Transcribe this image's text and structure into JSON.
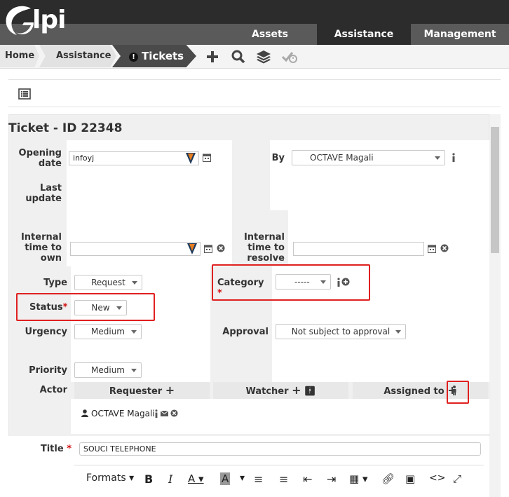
{
  "app": {
    "logo_text": "lpi"
  },
  "menu": {
    "assets": "Assets",
    "assistance": "Assistance",
    "management": "Management"
  },
  "breadcrumb": {
    "home": "Home",
    "assistance": "Assistance",
    "tickets": "Tickets"
  },
  "ticket": {
    "title": "Ticket - ID 22348",
    "opening_date_label": "Opening date",
    "opening_date_value": "infoyj",
    "by_label": "By",
    "by_value": "OCTAVE Magali",
    "last_update_label": "Last update",
    "internal_time_to_own_label": "Internal time to own",
    "internal_time_to_resolve_label": "Internal time to resolve",
    "type_label": "Type",
    "type_value": "Request",
    "category_label": "Category",
    "category_value": "-----",
    "status_label": "Status",
    "status_value": "New",
    "urgency_label": "Urgency",
    "urgency_value": "Medium",
    "approval_label": "Approval",
    "approval_value": "Not subject to approval",
    "priority_label": "Priority",
    "priority_value": "Medium",
    "actor_label": "Actor",
    "requester_label": "Requester",
    "watcher_label": "Watcher",
    "assigned_label": "Assigned to",
    "requester_name": "OCTAVE Magali",
    "title_label": "Title",
    "title_value": "SOUCI TELEPHONE"
  },
  "editor": {
    "formats_label": "Formats"
  },
  "colors": {
    "required": "#d01010",
    "highlight_box": "#e02020",
    "dark_bar": "#2c2c2c"
  }
}
